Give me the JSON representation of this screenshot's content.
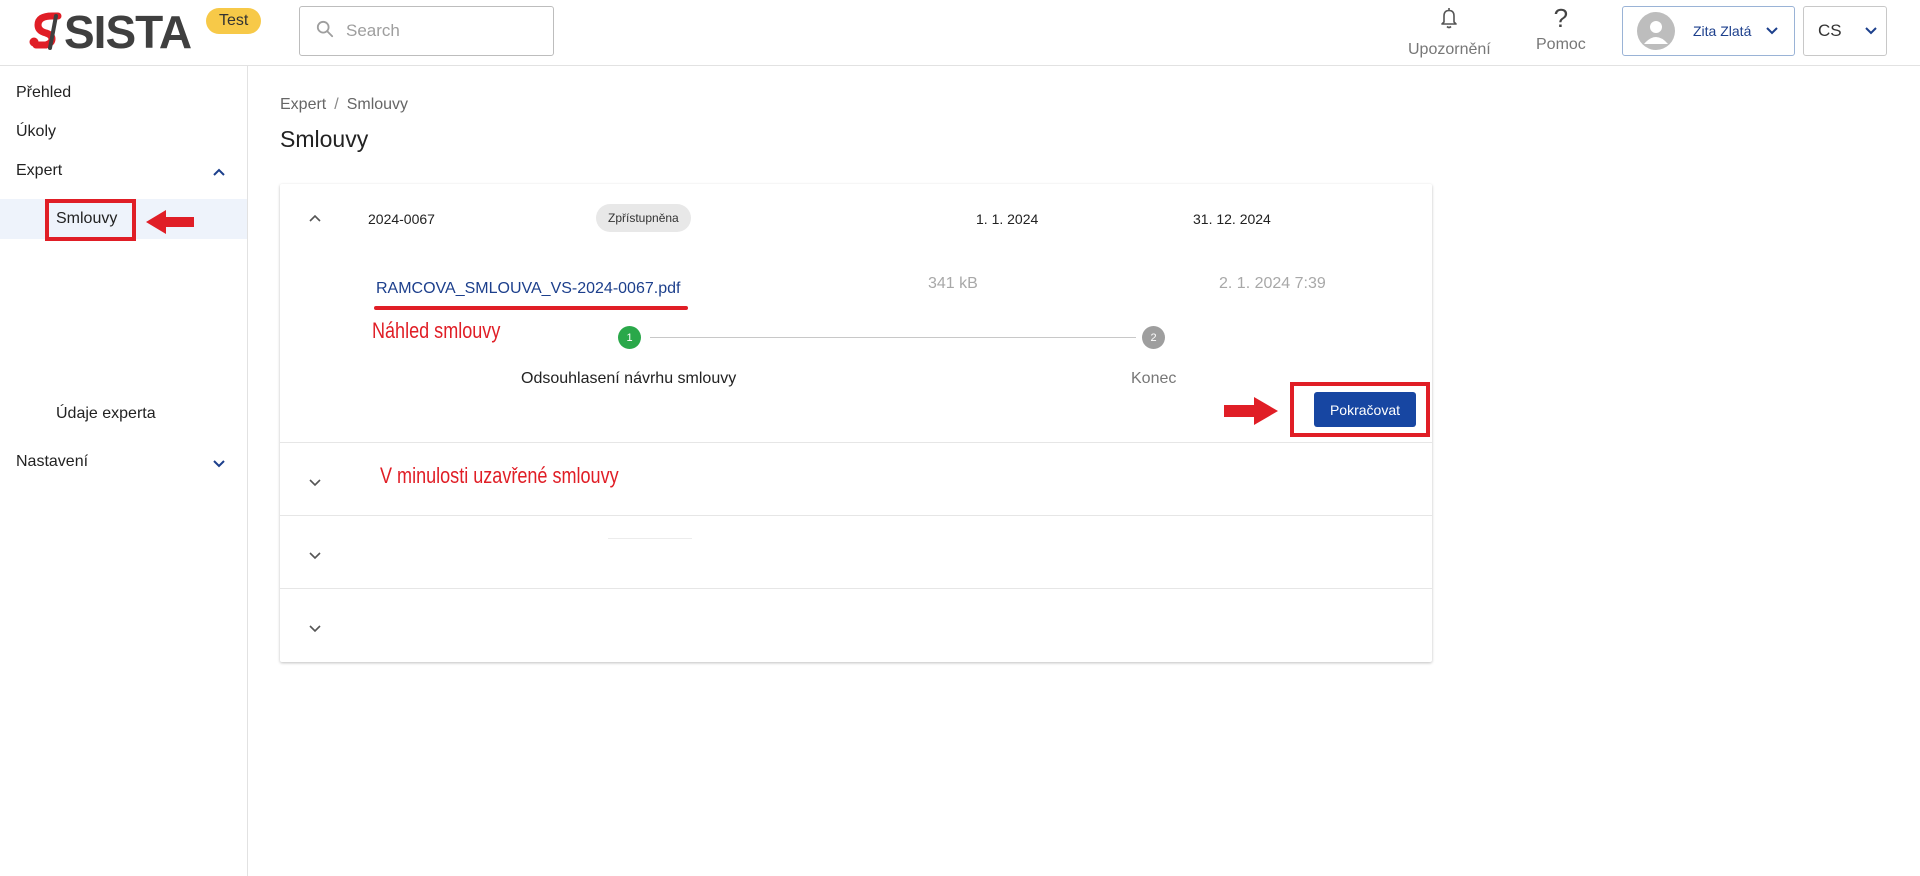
{
  "header": {
    "logo_text": "SISTA",
    "env_badge": "Test",
    "search": {
      "placeholder": "Search",
      "value": ""
    },
    "notifications_label": "Upozornění",
    "help_label": "Pomoc",
    "help_glyph": "?",
    "user_name": "Zita Zlatá",
    "language": "CS"
  },
  "sidebar": {
    "items": [
      {
        "label": "Přehled"
      },
      {
        "label": "Úkoly"
      },
      {
        "label": "Expert",
        "expanded": true
      },
      {
        "label": "Smlouvy",
        "active": true
      },
      {
        "label": "Údaje experta"
      },
      {
        "label": "Nastavení",
        "expanded": false
      }
    ]
  },
  "breadcrumb": [
    "Expert",
    "Smlouvy"
  ],
  "breadcrumb_separator": "/",
  "page_title": "Smlouvy",
  "contract": {
    "number": "2024-0067",
    "status": "Zpřístupněna",
    "valid_from": "1. 1. 2024",
    "valid_to": "31. 12. 2024",
    "file": {
      "name": "RAMCOVA_SMLOUVA_VS-2024-0067.pdf",
      "size": "341 kB",
      "date": "2. 1. 2024 7:39"
    },
    "steps": [
      {
        "number": "1",
        "label": "Odsouhlasení návrhu smlouvy",
        "status": "active"
      },
      {
        "number": "2",
        "label": "Konec",
        "status": "pending"
      }
    ],
    "continue_label": "Pokračovat"
  },
  "annotations": {
    "preview": "Náhled smlouvy",
    "past_contracts": "V minulosti uzavřené smlouvy"
  },
  "colors": {
    "brand_blue": "#1746a2",
    "annotation_red": "#e01e26",
    "step_active": "#2aa84a",
    "step_pending": "#9e9e9e",
    "badge_yellow": "#f7c948"
  }
}
